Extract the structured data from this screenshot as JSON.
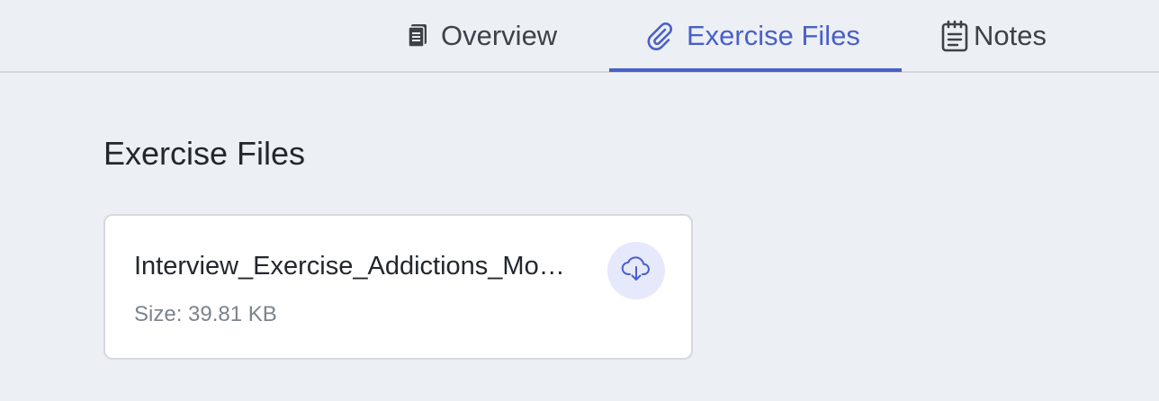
{
  "tabs": [
    {
      "label": "Overview",
      "icon": "document-icon",
      "active": false
    },
    {
      "label": "Exercise Files",
      "icon": "paperclip-icon",
      "active": true
    },
    {
      "label": "Notes",
      "icon": "notepad-icon",
      "active": false
    }
  ],
  "section": {
    "title": "Exercise Files"
  },
  "files": [
    {
      "name": "Interview_Exercise_Addictions_Module.docx",
      "size": "Size: 39.81 KB",
      "download_icon": "cloud-download-icon"
    }
  ],
  "colors": {
    "accent": "#4a5fc9",
    "background": "#eceff3",
    "card": "#ffffff",
    "download_bg": "#e6e8fb"
  }
}
